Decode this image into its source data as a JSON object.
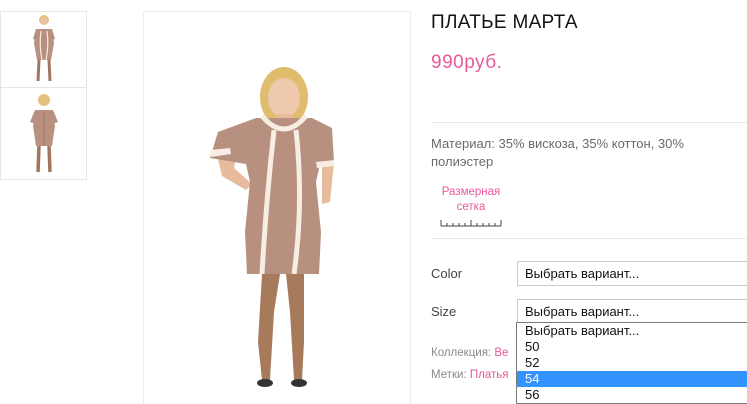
{
  "product": {
    "title": "ПЛАТЬЕ МАРТА",
    "price": "990руб.",
    "description": "Материал: 35% вискоза, 35% коттон, 30% полиэстер",
    "size_chart_label": "Размерная сетка"
  },
  "variations": [
    {
      "label": "Color",
      "selected": "Выбрать вариант..."
    },
    {
      "label": "Size",
      "selected": "Выбрать вариант..."
    }
  ],
  "size_dropdown": {
    "options": [
      "Выбрать вариант...",
      "50",
      "52",
      "54",
      "56"
    ],
    "highlighted": "54"
  },
  "meta": {
    "collection_label": "Коллекция:",
    "collection_value": "Ве",
    "tags_label": "Метки:",
    "tags_value": "Платья"
  },
  "colors": {
    "accent": "#e85a9b",
    "dress": "#b8907f",
    "trim": "#f7ede2",
    "highlight": "#3393ff"
  }
}
